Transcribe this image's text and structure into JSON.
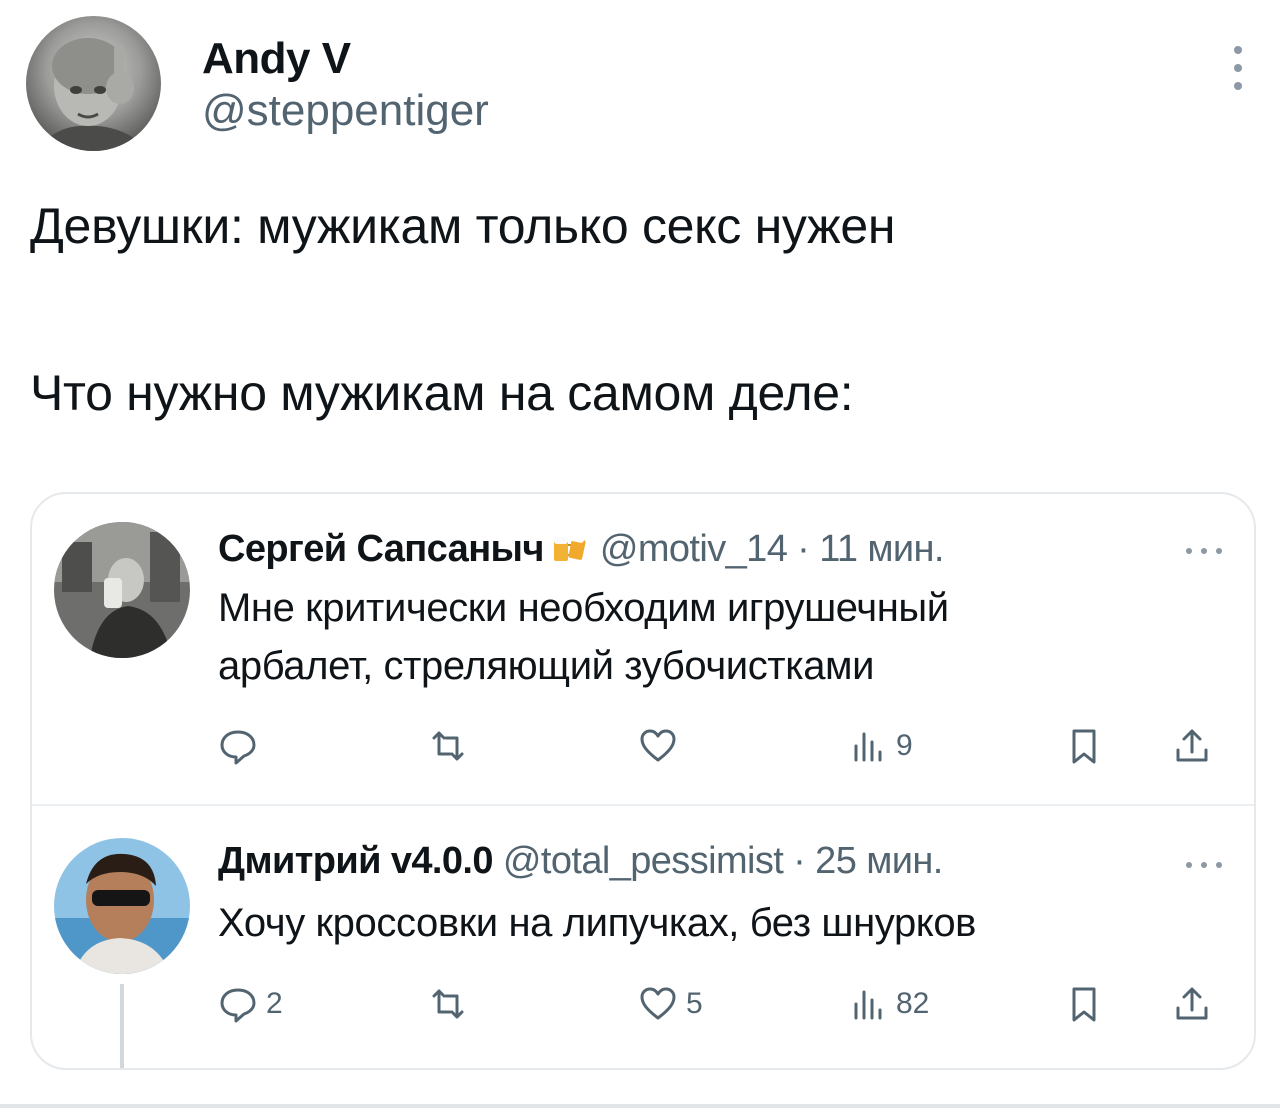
{
  "author": {
    "name": "Andy V",
    "handle": "@steppentiger"
  },
  "tweet": {
    "line1": "Девушки: мужикам только секс нужен",
    "line2": "Что нужно мужикам на самом деле:"
  },
  "quote": {
    "replies": [
      {
        "name": "Сергей Сапсаныч",
        "emoji_icon": "beer-mugs-icon",
        "meta": "@motiv_14 · 11 мин.",
        "text_line1": "Мне критически необходим игрушечный",
        "text_line2": "арбалет, стреляющий зубочистками",
        "replies_count": "",
        "likes_count": "",
        "views_count": "9"
      },
      {
        "name": "Дмитрий v4.0.0",
        "meta": "@total_pessimist · 25 мин.",
        "text_line1": "Хочу кроссовки на липучках, без шнурков",
        "replies_count": "2",
        "likes_count": "5",
        "views_count": "82"
      }
    ]
  },
  "colors": {
    "text": "#0f1419",
    "secondary": "#536471",
    "border": "#e6e9ec"
  }
}
